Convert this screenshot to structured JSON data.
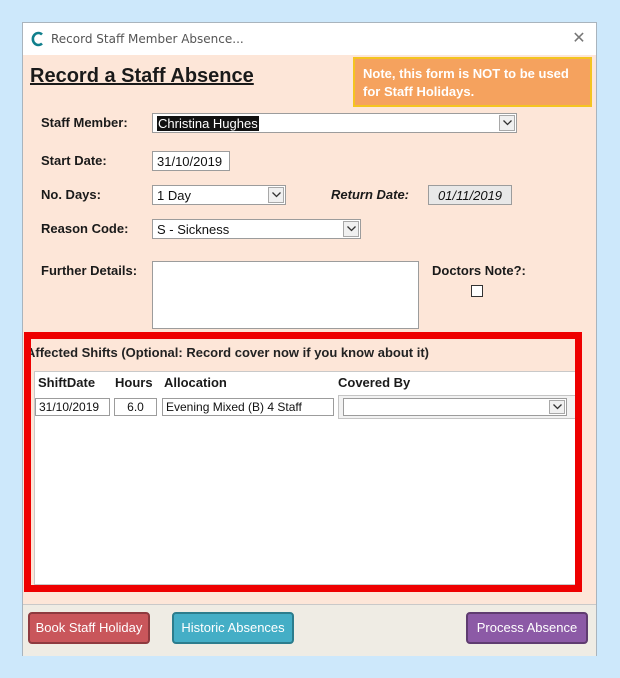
{
  "window": {
    "title": "Record Staff Member Absence...",
    "close_glyph": "✕"
  },
  "form": {
    "heading": "Record a Staff Absence",
    "notice": "Note, this form is NOT to be used for Staff Holidays.",
    "staff_member": {
      "label": "Staff Member:",
      "value": "Christina Hughes"
    },
    "start_date": {
      "label": "Start Date:",
      "value": "31/10/2019"
    },
    "no_days": {
      "label": "No. Days:",
      "value": "1 Day"
    },
    "return_date": {
      "label": "Return Date:",
      "value": "01/11/2019"
    },
    "reason_code": {
      "label": "Reason Code:",
      "value": "S - Sickness"
    },
    "further_details": {
      "label": "Further Details:",
      "value": ""
    },
    "doctors_note": {
      "label": "Doctors Note?:",
      "checked": false
    }
  },
  "shifts": {
    "title": "Affected Shifts (Optional: Record cover now if you know about it)",
    "columns": [
      "ShiftDate",
      "Hours",
      "Allocation",
      "Covered By"
    ],
    "rows": [
      {
        "shift_date": "31/10/2019",
        "hours": "6.0",
        "allocation": "Evening Mixed (B) 4 Staff",
        "covered_by": ""
      }
    ]
  },
  "footer": {
    "book_holiday": "Book Staff Holiday",
    "historic_absences": "Historic Absences",
    "process_absence": "Process Absence"
  },
  "colors": {
    "form_background": "#fde6d8",
    "notice_background": "#f5a25e",
    "highlight_border": "#ee0000",
    "book_holiday_button": "#c9565b",
    "historic_button": "#44aec6",
    "process_button": "#8c5aa6"
  },
  "icons": {
    "app": "app-logo-icon",
    "close": "close-icon",
    "dropdown": "chevron-down-icon"
  }
}
